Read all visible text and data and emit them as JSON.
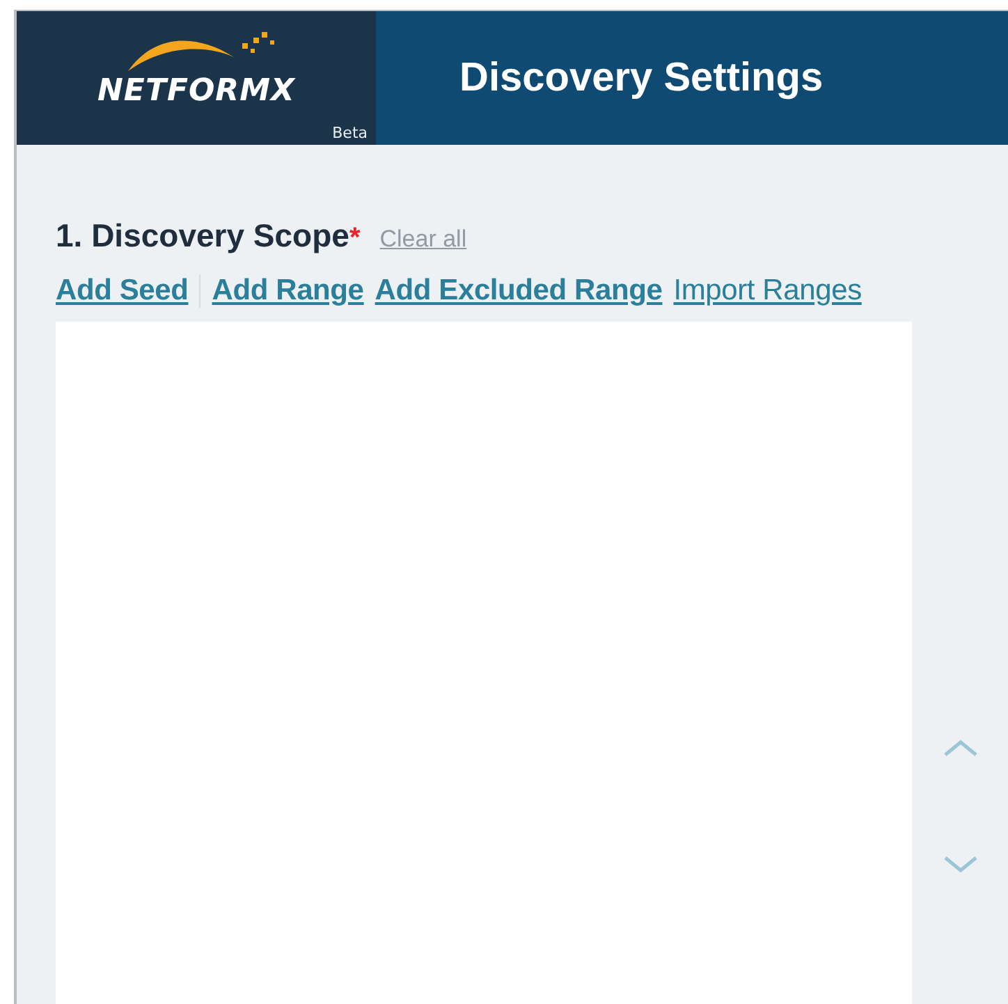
{
  "header": {
    "logo_text": "NETFORMX",
    "badge": "Beta",
    "title": "Discovery Settings"
  },
  "section": {
    "heading": "1. Discovery Scope",
    "required_mark": "*",
    "clear_link": {
      "label": "Clear all",
      "disabled": true
    }
  },
  "actions": [
    {
      "label": "Add Seed",
      "kind": "primary",
      "separator_after": true
    },
    {
      "label": "Add Range",
      "kind": "primary",
      "separator_after": false
    },
    {
      "label": "Add Excluded Range",
      "kind": "primary",
      "separator_after": false
    },
    {
      "label": "Import Ranges",
      "kind": "secondary",
      "separator_after": false
    }
  ]
}
